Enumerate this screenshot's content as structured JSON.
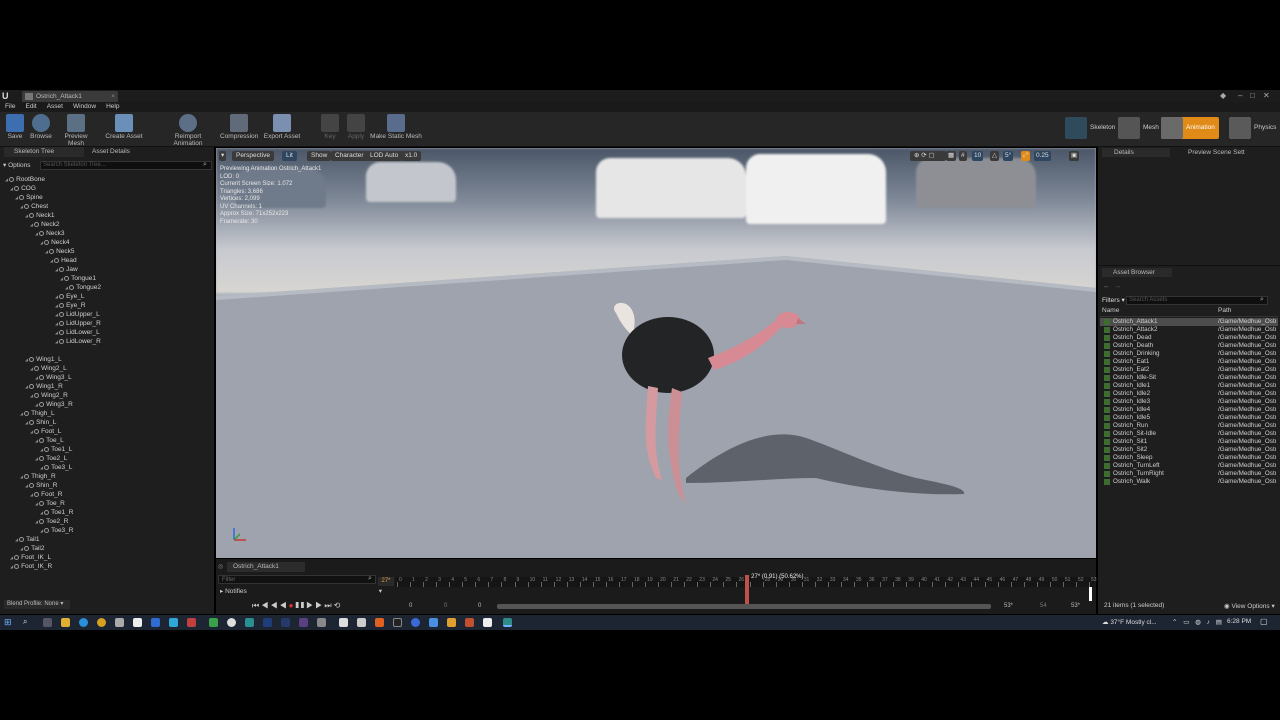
{
  "window": {
    "tab_title": "Ostrich_Attack1",
    "logo": "U"
  },
  "menu": [
    "File",
    "Edit",
    "Asset",
    "Window",
    "Help"
  ],
  "toolbar": {
    "buttons": [
      {
        "label": "Save",
        "icon": "save-icon"
      },
      {
        "label": "Browse",
        "icon": "browse-icon"
      },
      {
        "label": "Preview Mesh",
        "icon": "preview-mesh-icon"
      },
      {
        "label": "Create Asset",
        "icon": "create-asset-icon"
      },
      {
        "label": "Reimport Animation",
        "icon": "reimport-icon"
      },
      {
        "label": "Compression",
        "icon": "compression-icon"
      },
      {
        "label": "Export Asset",
        "icon": "export-icon"
      },
      {
        "label": "Key",
        "icon": "plus-icon",
        "disabled": true
      },
      {
        "label": "Apply",
        "icon": "apply-icon",
        "disabled": true
      },
      {
        "label": "Make Static Mesh",
        "icon": "static-mesh-icon"
      }
    ],
    "modes": [
      {
        "label": "Skeleton",
        "color": "#3d6f87"
      },
      {
        "label": "Mesh",
        "color": "#a33aa8"
      },
      {
        "label": "Animation",
        "color": "#e08a18",
        "active": true
      },
      {
        "label": "Physics",
        "color": "#6a6a6a"
      }
    ]
  },
  "left_panel": {
    "tabs": [
      "Skeleton Tree",
      "Asset Details"
    ],
    "options_label": "Options",
    "search_placeholder": "Search Skeleton Tree...",
    "bones": [
      {
        "name": "RootBone",
        "depth": 0
      },
      {
        "name": "COG",
        "depth": 1
      },
      {
        "name": "Spine",
        "depth": 2
      },
      {
        "name": "Chest",
        "depth": 3
      },
      {
        "name": "Neck1",
        "depth": 4
      },
      {
        "name": "Neck2",
        "depth": 5
      },
      {
        "name": "Neck3",
        "depth": 6
      },
      {
        "name": "Neck4",
        "depth": 7
      },
      {
        "name": "Neck5",
        "depth": 8
      },
      {
        "name": "Head",
        "depth": 9
      },
      {
        "name": "Jaw",
        "depth": 10
      },
      {
        "name": "Tongue1",
        "depth": 11
      },
      {
        "name": "Tongue2",
        "depth": 12
      },
      {
        "name": "Eye_L",
        "depth": 10
      },
      {
        "name": "Eye_R",
        "depth": 10
      },
      {
        "name": "LidUpper_L",
        "depth": 10
      },
      {
        "name": "LidUpper_R",
        "depth": 10
      },
      {
        "name": "LidLower_L",
        "depth": 10
      },
      {
        "name": "LidLower_R",
        "depth": 10
      },
      {
        "name": "",
        "depth": 0
      },
      {
        "name": "Wing1_L",
        "depth": 4
      },
      {
        "name": "Wing2_L",
        "depth": 5
      },
      {
        "name": "Wing3_L",
        "depth": 6
      },
      {
        "name": "Wing1_R",
        "depth": 4
      },
      {
        "name": "Wing2_R",
        "depth": 5
      },
      {
        "name": "Wing3_R",
        "depth": 6
      },
      {
        "name": "Thigh_L",
        "depth": 3
      },
      {
        "name": "Shin_L",
        "depth": 4
      },
      {
        "name": "Foot_L",
        "depth": 5
      },
      {
        "name": "Toe_L",
        "depth": 6
      },
      {
        "name": "Toe1_L",
        "depth": 7
      },
      {
        "name": "Toe2_L",
        "depth": 6
      },
      {
        "name": "Toe3_L",
        "depth": 7
      },
      {
        "name": "Thigh_R",
        "depth": 3
      },
      {
        "name": "Shin_R",
        "depth": 4
      },
      {
        "name": "Foot_R",
        "depth": 5
      },
      {
        "name": "Toe_R",
        "depth": 6
      },
      {
        "name": "Toe1_R",
        "depth": 7
      },
      {
        "name": "Toe2_R",
        "depth": 6
      },
      {
        "name": "Toe3_R",
        "depth": 7
      },
      {
        "name": "Tail1",
        "depth": 2
      },
      {
        "name": "Tail2",
        "depth": 3
      },
      {
        "name": "Foot_IK_L",
        "depth": 1
      },
      {
        "name": "Foot_IK_R",
        "depth": 1
      }
    ],
    "blend_profile": "Blend Profile: None"
  },
  "viewport": {
    "perspective": "Perspective",
    "lit": "Lit",
    "show": "Show",
    "character": "Character",
    "lod": "LOD Auto",
    "speed": "x1.0",
    "stats": [
      "Previewing Animation Ostrich_Attack1",
      "LOD: 0",
      "Current Screen Size: 1.072",
      "Triangles: 3,686",
      "Vertices: 2,099",
      "UV Channels: 1",
      "Approx Size: 71x252x223",
      "Framerate: 30"
    ],
    "grid_value": "10",
    "angle_value": "5°",
    "scale_value": "0.25"
  },
  "timeline": {
    "tab": "Ostrich_Attack1",
    "filter_placeholder": "Filter",
    "notifies_label": "Notifies",
    "current_frame": "27",
    "playhead_label": "27* (0.91) (50.62%)",
    "total_frames": 53,
    "playhead_fraction": 0.506,
    "range_start": "0",
    "range_start2": "0",
    "range_start3": "0",
    "range_end": "53*",
    "range_end2": "54",
    "range_end3": "53*"
  },
  "right_panel": {
    "details_tab": "Details",
    "preview_tab": "Preview Scene Sett",
    "asset_browser_tab": "Asset Browser",
    "filters_label": "Filters",
    "search_placeholder": "Search Assets",
    "col_name": "Name",
    "col_path": "Path",
    "assets": [
      "Ostrich_Attack1",
      "Ostrich_Attack2",
      "Ostrich_Dead",
      "Ostrich_Death",
      "Ostrich_Drinking",
      "Ostrich_Eat1",
      "Ostrich_Eat2",
      "Ostrich_Idle-Sit",
      "Ostrich_Idle1",
      "Ostrich_Idle2",
      "Ostrich_Idle3",
      "Ostrich_Idle4",
      "Ostrich_Idle5",
      "Ostrich_Run",
      "Ostrich_Sit-Idle",
      "Ostrich_Sit1",
      "Ostrich_Sit2",
      "Ostrich_Sleep",
      "Ostrich_TurnLeft",
      "Ostrich_TurnRight",
      "Ostrich_Walk"
    ],
    "asset_path": "/Game/Medhue_Ostri",
    "status": "21 items (1 selected)",
    "view_options": "View Options"
  },
  "taskbar": {
    "weather": "37°F  Mostly cl...",
    "time": "6:28 PM"
  },
  "colors": {
    "accent": "#e08a18",
    "selection": "#4d4d4d",
    "ostrich_body": "#222426",
    "ostrich_neck": "#d88a94"
  }
}
